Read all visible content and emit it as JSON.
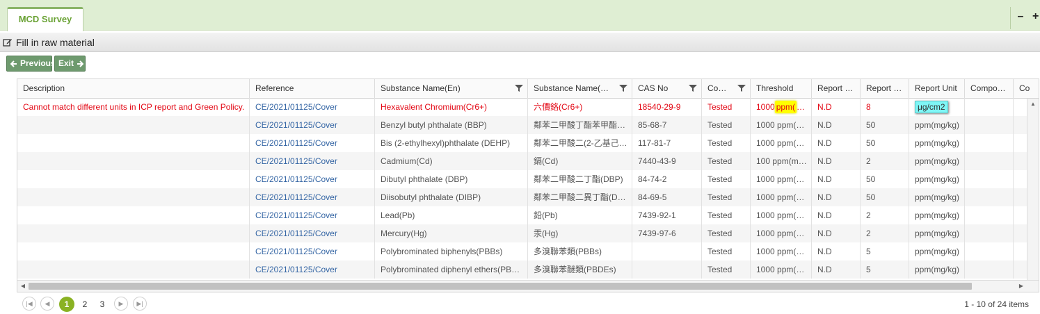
{
  "tab": {
    "label": "MCD Survey"
  },
  "window": {
    "minimize": "–",
    "dock": "+"
  },
  "titlebar": {
    "label": "Fill in raw material"
  },
  "toolbar": {
    "previous_label": "Previous",
    "exit_label": "Exit"
  },
  "columns": [
    "Description",
    "Reference",
    "Substance Name(En)",
    "Substance Name(…",
    "CAS No",
    "Co…",
    "Threshold",
    "Report …",
    "Report …",
    "Report Unit",
    "Compo…",
    "Co"
  ],
  "rows": [
    {
      "description": "Cannot match different units in ICP report and Green Policy.",
      "reference": "CE/2021/01125/Cover",
      "name_en": "Hexavalent Chromium(Cr6+)",
      "name_zh": "六價鉻(Cr6+)",
      "cas": "18540-29-9",
      "status": "Tested",
      "threshold_a": "1000",
      "threshold_b": "ppm(",
      "threshold_c": "…",
      "report_a": "N.D",
      "report_b": "8",
      "unit": "μg/cm2",
      "compo": "",
      "co": ""
    },
    {
      "description": "",
      "reference": "CE/2021/01125/Cover",
      "name_en": "Benzyl butyl phthalate (BBP)",
      "name_zh": "鄰苯二甲酸丁酯苯甲酯…",
      "cas": "85-68-7",
      "status": "Tested",
      "threshold": "1000 ppm(…",
      "report_a": "N.D",
      "report_b": "50",
      "unit": "ppm(mg/kg)",
      "compo": "",
      "co": ""
    },
    {
      "description": "",
      "reference": "CE/2021/01125/Cover",
      "name_en": "Bis (2-ethylhexyl)phthalate (DEHP)",
      "name_zh": "鄰苯二甲酸二(2-乙基己…",
      "cas": "117-81-7",
      "status": "Tested",
      "threshold": "1000 ppm(…",
      "report_a": "N.D",
      "report_b": "50",
      "unit": "ppm(mg/kg)",
      "compo": "",
      "co": ""
    },
    {
      "description": "",
      "reference": "CE/2021/01125/Cover",
      "name_en": "Cadmium(Cd)",
      "name_zh": "鎘(Cd)",
      "cas": "7440-43-9",
      "status": "Tested",
      "threshold": "100 ppm(m…",
      "report_a": "N.D",
      "report_b": "2",
      "unit": "ppm(mg/kg)",
      "compo": "",
      "co": ""
    },
    {
      "description": "",
      "reference": "CE/2021/01125/Cover",
      "name_en": "Dibutyl phthalate (DBP)",
      "name_zh": "鄰苯二甲酸二丁酯(DBP)",
      "cas": "84-74-2",
      "status": "Tested",
      "threshold": "1000 ppm(…",
      "report_a": "N.D",
      "report_b": "50",
      "unit": "ppm(mg/kg)",
      "compo": "",
      "co": ""
    },
    {
      "description": "",
      "reference": "CE/2021/01125/Cover",
      "name_en": "Diisobutyl phthalate (DIBP)",
      "name_zh": "鄰苯二甲酸二異丁酯(D…",
      "cas": "84-69-5",
      "status": "Tested",
      "threshold": "1000 ppm(…",
      "report_a": "N.D",
      "report_b": "50",
      "unit": "ppm(mg/kg)",
      "compo": "",
      "co": ""
    },
    {
      "description": "",
      "reference": "CE/2021/01125/Cover",
      "name_en": "Lead(Pb)",
      "name_zh": "鉛(Pb)",
      "cas": "7439-92-1",
      "status": "Tested",
      "threshold": "1000 ppm(…",
      "report_a": "N.D",
      "report_b": "2",
      "unit": "ppm(mg/kg)",
      "compo": "",
      "co": ""
    },
    {
      "description": "",
      "reference": "CE/2021/01125/Cover",
      "name_en": "Mercury(Hg)",
      "name_zh": "汞(Hg)",
      "cas": "7439-97-6",
      "status": "Tested",
      "threshold": "1000 ppm(…",
      "report_a": "N.D",
      "report_b": "2",
      "unit": "ppm(mg/kg)",
      "compo": "",
      "co": ""
    },
    {
      "description": "",
      "reference": "CE/2021/01125/Cover",
      "name_en": "Polybrominated biphenyls(PBBs)",
      "name_zh": "多溴聯苯類(PBBs)",
      "cas": "",
      "status": "Tested",
      "threshold": "1000 ppm(…",
      "report_a": "N.D",
      "report_b": "5",
      "unit": "ppm(mg/kg)",
      "compo": "",
      "co": ""
    },
    {
      "description": "",
      "reference": "CE/2021/01125/Cover",
      "name_en": "Polybrominated diphenyl ethers(PB…",
      "name_zh": "多溴聯苯醚類(PBDEs)",
      "cas": "",
      "status": "Tested",
      "threshold": "1000 ppm(…",
      "report_a": "N.D",
      "report_b": "5",
      "unit": "ppm(mg/kg)",
      "compo": "",
      "co": ""
    }
  ],
  "pager": {
    "pages": [
      "1",
      "2",
      "3"
    ],
    "active": "1",
    "info": "1 - 10 of 24 items"
  },
  "colors": {
    "tab_accent": "#6aa235",
    "alert": "#e30613",
    "link": "#3465a4",
    "pager_active": "#8ab223"
  }
}
